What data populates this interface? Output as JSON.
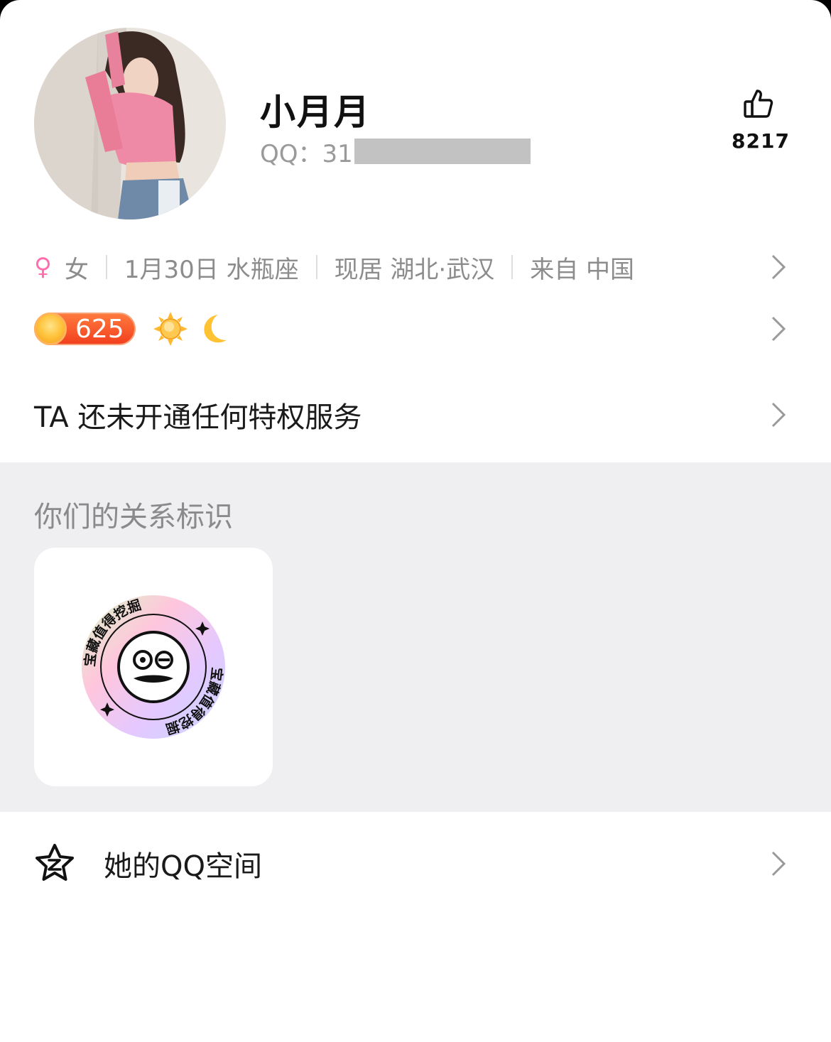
{
  "profile": {
    "name": "小月月",
    "qq_label": "QQ：31",
    "like_count": "8217"
  },
  "info": {
    "gender_symbol": "♀",
    "gender": "女",
    "birthday": "1月30日 水瓶座",
    "residence": "现居 湖北·武汉",
    "origin": "来自 中国"
  },
  "level": {
    "value": "625"
  },
  "privilege": {
    "text": "TA 还未开通任何特权服务"
  },
  "relation": {
    "title": "你们的关系标识",
    "badge_text": "宝藏值得挖掘"
  },
  "qzone": {
    "label": "她的QQ空间"
  },
  "colors": {
    "accent_pink": "#ff6fae",
    "level_badge": "#f2401f",
    "section_bg": "#efeff2"
  },
  "icons": {
    "like": "thumbs-up-icon",
    "chevron": "chevron-right-icon",
    "gender": "female-icon",
    "level": "crown-icon",
    "sun": "sun-icon",
    "moon": "moon-icon",
    "qzone": "star-icon"
  }
}
